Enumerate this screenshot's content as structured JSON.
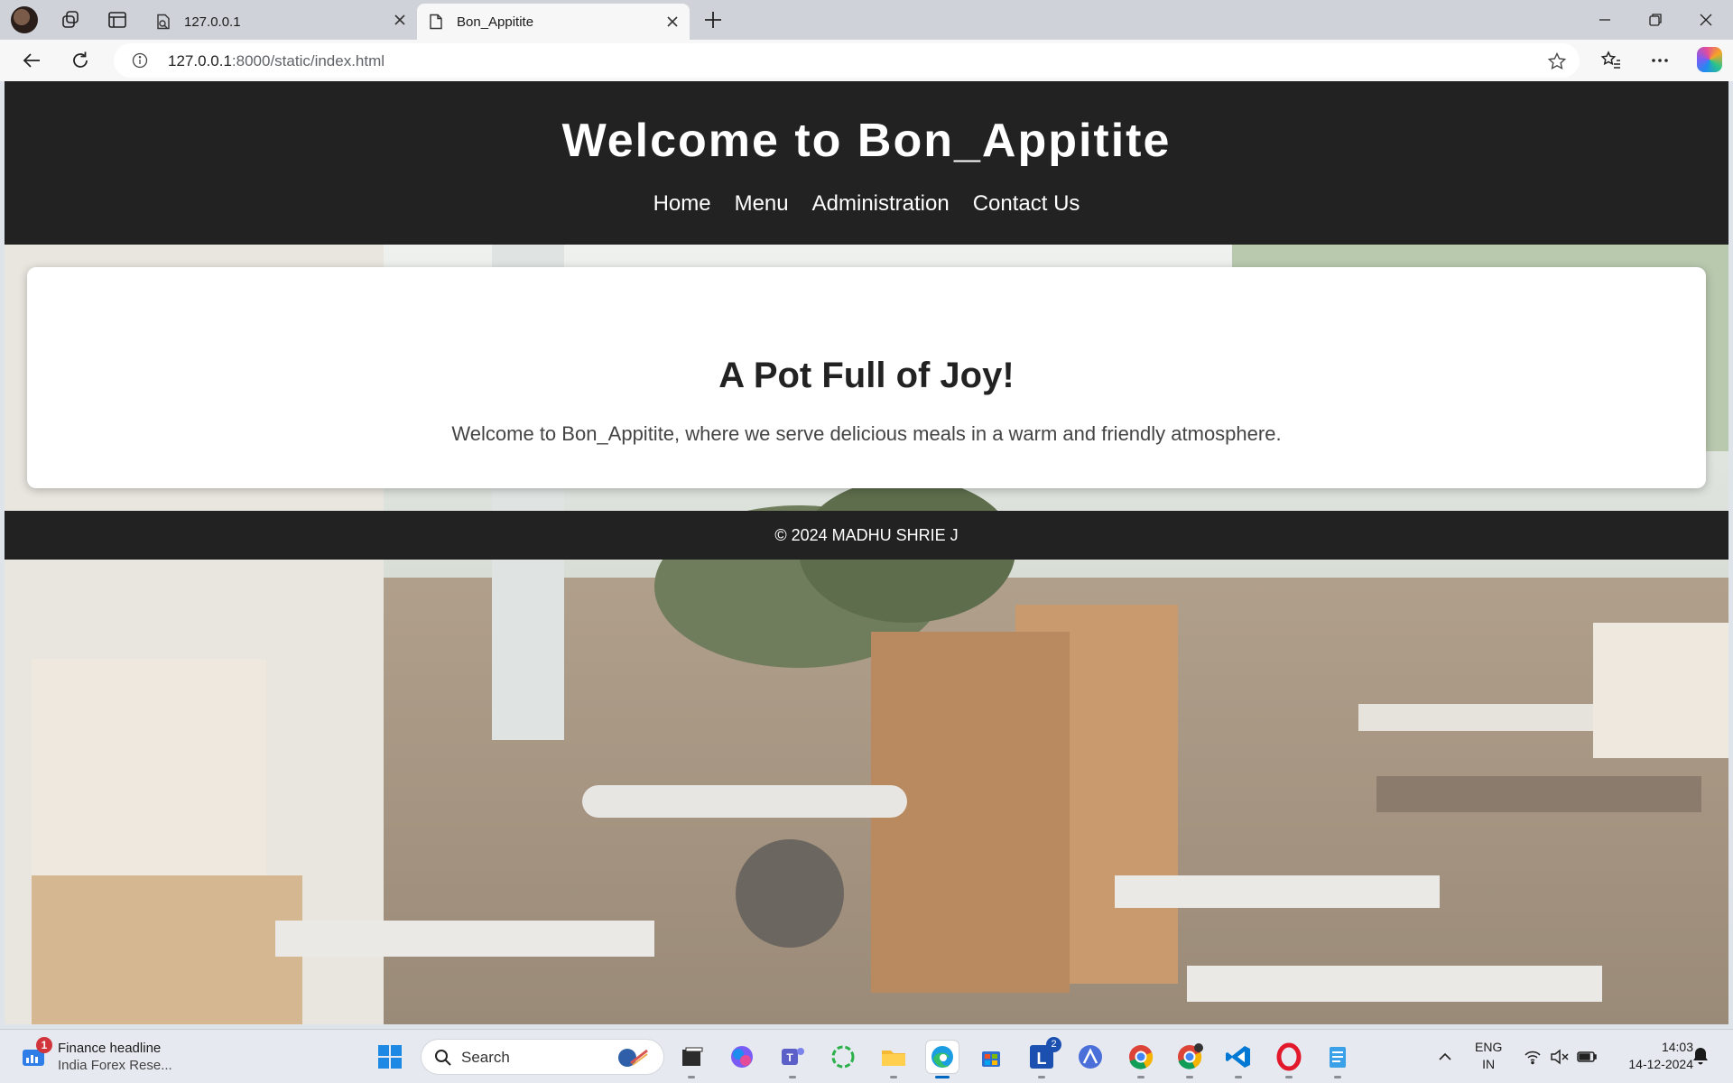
{
  "browser": {
    "tabs": [
      {
        "title": "127.0.0.1",
        "active": false
      },
      {
        "title": "Bon_Appitite",
        "active": true
      }
    ],
    "address": {
      "host": "127.0.0.1",
      "path": ":8000/static/index.html"
    }
  },
  "page": {
    "header": {
      "title": "Welcome to Bon_Appitite",
      "nav": [
        "Home",
        "Menu",
        "Administration",
        "Contact Us"
      ]
    },
    "hero": {
      "heading": "A Pot Full of Joy!",
      "text": "Welcome to Bon_Appitite, where we serve delicious meals in a warm and friendly atmosphere."
    },
    "footer": {
      "text": "© 2024 MADHU SHRIE J"
    }
  },
  "taskbar": {
    "widget": {
      "headline": "Finance headline",
      "subtitle": "India Forex Rese...",
      "badge": "1"
    },
    "search_label": "Search",
    "apps": [
      {
        "name": "file-explorer"
      },
      {
        "name": "copilot"
      },
      {
        "name": "teams"
      },
      {
        "name": "refresh-app"
      },
      {
        "name": "folder"
      },
      {
        "name": "edge"
      },
      {
        "name": "store"
      },
      {
        "name": "l-app",
        "badge": "2"
      },
      {
        "name": "arc-app"
      },
      {
        "name": "chrome"
      },
      {
        "name": "chrome-profile"
      },
      {
        "name": "vscode"
      },
      {
        "name": "opera"
      },
      {
        "name": "notepad"
      }
    ],
    "language": {
      "line1": "ENG",
      "line2": "IN"
    },
    "clock": {
      "time": "14:03",
      "date": "14-12-2024"
    }
  },
  "colors": {
    "header_bg": "#222222",
    "card_bg": "#ffffff",
    "accent": "#0067c0"
  }
}
